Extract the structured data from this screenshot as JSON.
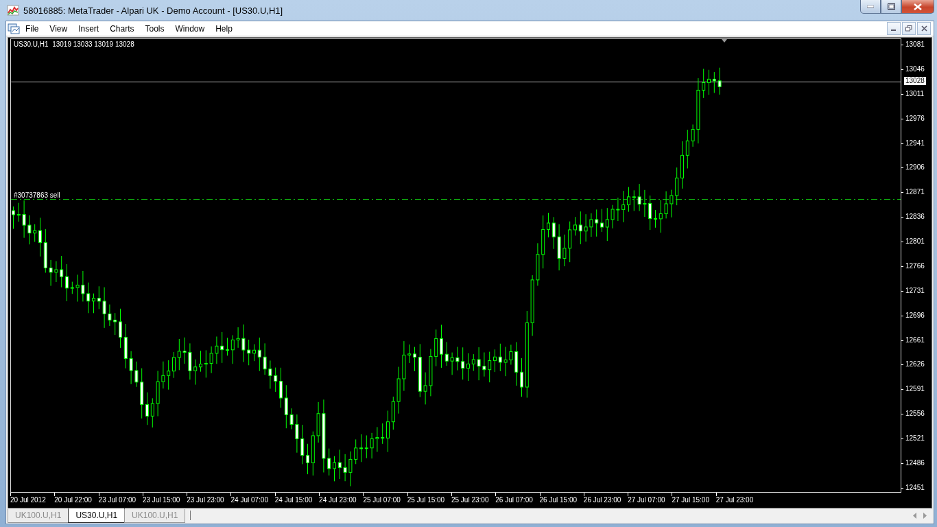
{
  "window": {
    "title": "58016885: MetaTrader - Alpari UK - Demo Account - [US30.U,H1]"
  },
  "menu": [
    "File",
    "View",
    "Insert",
    "Charts",
    "Tools",
    "Window",
    "Help"
  ],
  "chart": {
    "header": "US30.U,H1  13019 13033 13019 13028",
    "order_label": "#30737863 sell",
    "current_price": "13028",
    "price_axis": [
      "13081",
      "13046",
      "13011",
      "12976",
      "12941",
      "12906",
      "12871",
      "12836",
      "12801",
      "12766",
      "12731",
      "12696",
      "12661",
      "12626",
      "12591",
      "12556",
      "12521",
      "12486",
      "12451"
    ],
    "time_axis": [
      "20 Jul 2012",
      "20 Jul 22:00",
      "23 Jul 07:00",
      "23 Jul 15:00",
      "23 Jul 23:00",
      "24 Jul 07:00",
      "24 Jul 15:00",
      "24 Jul 23:00",
      "25 Jul 07:00",
      "25 Jul 15:00",
      "25 Jul 23:00",
      "26 Jul 07:00",
      "26 Jul 15:00",
      "26 Jul 23:00",
      "27 Jul 07:00",
      "27 Jul 15:00",
      "27 Jul 23:00"
    ]
  },
  "tabs": [
    {
      "label": "UK100.U,H1",
      "selected": false
    },
    {
      "label": "US30.U,H1",
      "selected": true
    },
    {
      "label": "UK100.U,H1",
      "selected": false
    }
  ]
}
